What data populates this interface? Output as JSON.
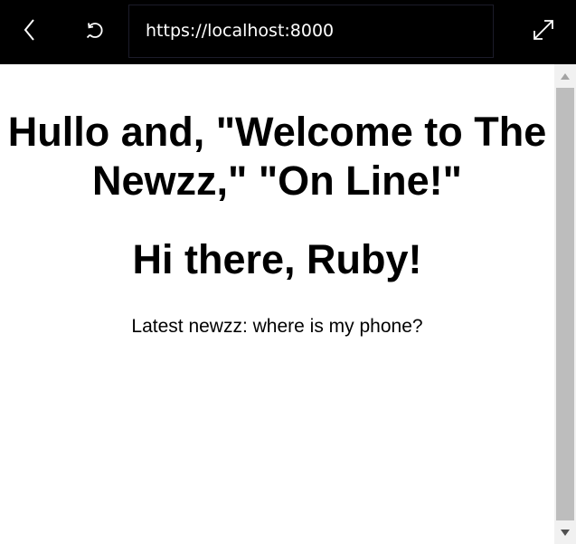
{
  "browser": {
    "url": "https://localhost:8000",
    "back_icon": "chevron-left-icon",
    "reload_icon": "refresh-icon",
    "expand_icon": "expand-diagonal-icon",
    "toolbar_color": "#000000",
    "text_color": "#ffffff"
  },
  "page": {
    "headline": "Hullo and, \"Welcome to The Newzz,\" \"On Line!\"",
    "greeting": "Hi there, Ruby!",
    "latest_news": "Latest newzz: where is my phone?"
  },
  "scrollbar": {
    "track_color": "#f1f1f1",
    "thumb_color": "#bdbdbd",
    "scroll_position": 0
  }
}
